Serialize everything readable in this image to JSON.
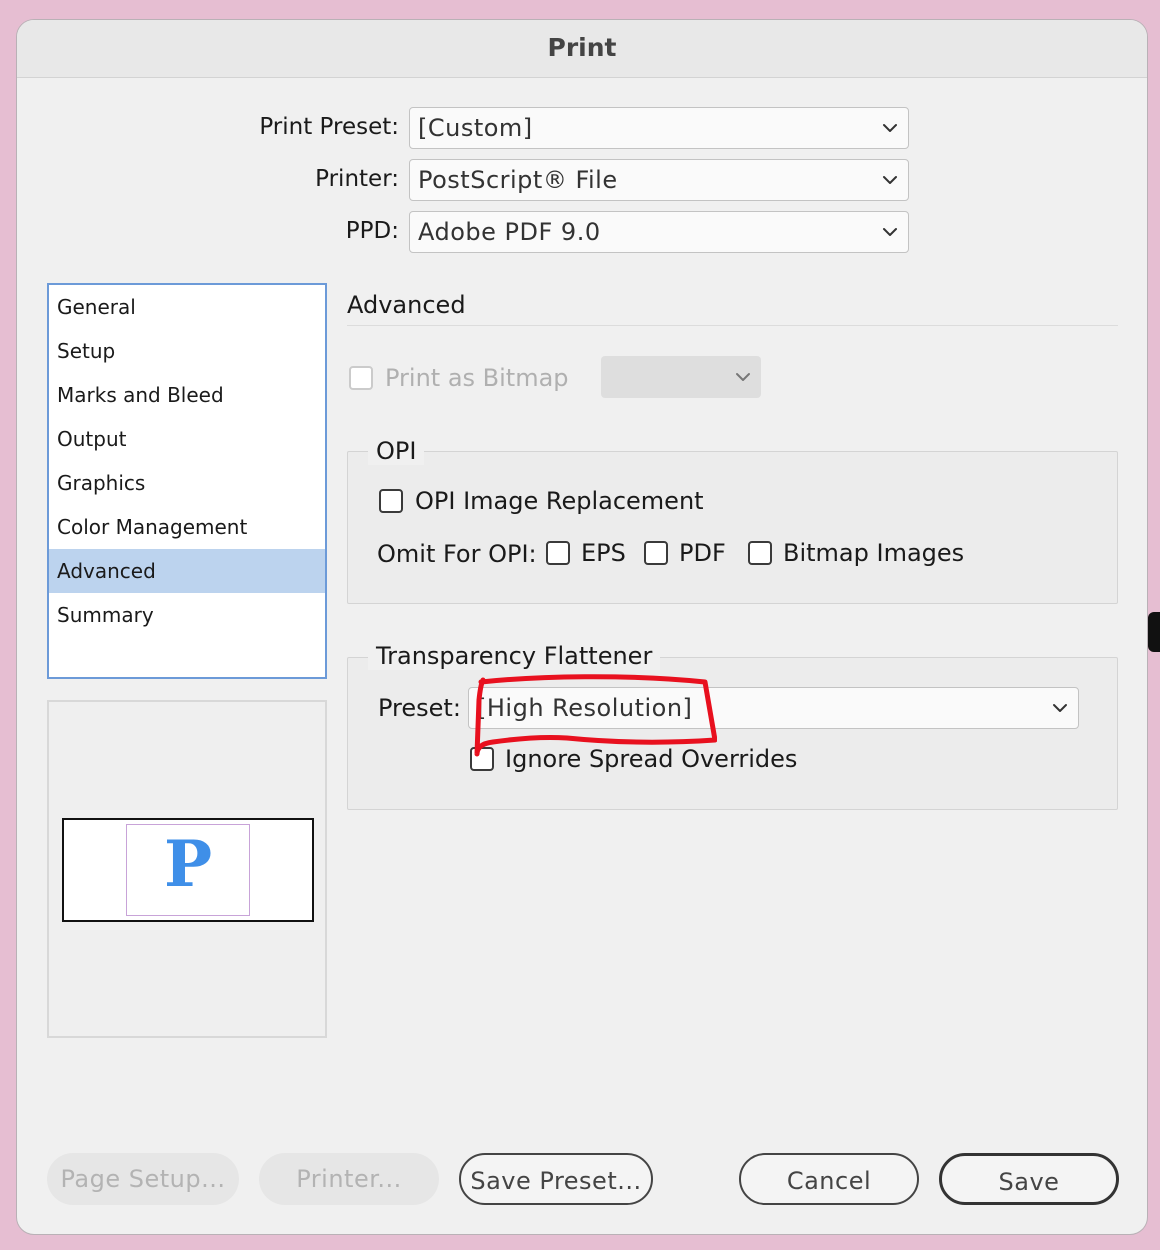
{
  "window": {
    "title": "Print"
  },
  "top": {
    "preset_label": "Print Preset:",
    "preset_value": "[Custom]",
    "printer_label": "Printer:",
    "printer_value": "PostScript® File",
    "ppd_label": "PPD:",
    "ppd_value": "Adobe PDF 9.0"
  },
  "sidebar": {
    "items": [
      {
        "label": "General"
      },
      {
        "label": "Setup"
      },
      {
        "label": "Marks and Bleed"
      },
      {
        "label": "Output"
      },
      {
        "label": "Graphics"
      },
      {
        "label": "Color Management"
      },
      {
        "label": "Advanced",
        "selected": true
      },
      {
        "label": "Summary"
      }
    ]
  },
  "preview": {
    "glyph": "P"
  },
  "main": {
    "heading": "Advanced",
    "print_as_bitmap": {
      "label": "Print as Bitmap",
      "checked": false,
      "disabled": true
    },
    "opi": {
      "title": "OPI",
      "image_replacement_label": "OPI Image Replacement",
      "omit_label": "Omit For OPI:",
      "eps_label": "EPS",
      "pdf_label": "PDF",
      "bitmap_images_label": "Bitmap Images"
    },
    "flattener": {
      "title": "Transparency Flattener",
      "preset_label": "Preset:",
      "preset_value": "[High Resolution]",
      "ignore_label": "Ignore Spread Overrides"
    }
  },
  "buttons": {
    "page_setup": "Page Setup...",
    "printer": "Printer...",
    "save_preset": "Save Preset...",
    "cancel": "Cancel",
    "save": "Save"
  },
  "colors": {
    "nav_selected": "#bcd3ee",
    "nav_border": "#6c9ad8",
    "annotation": "#e8101e",
    "preview_glyph": "#3f8fe8"
  },
  "icons": {
    "dropdown": "chevron-down-icon",
    "annotation": "red-highlight-scribble"
  }
}
